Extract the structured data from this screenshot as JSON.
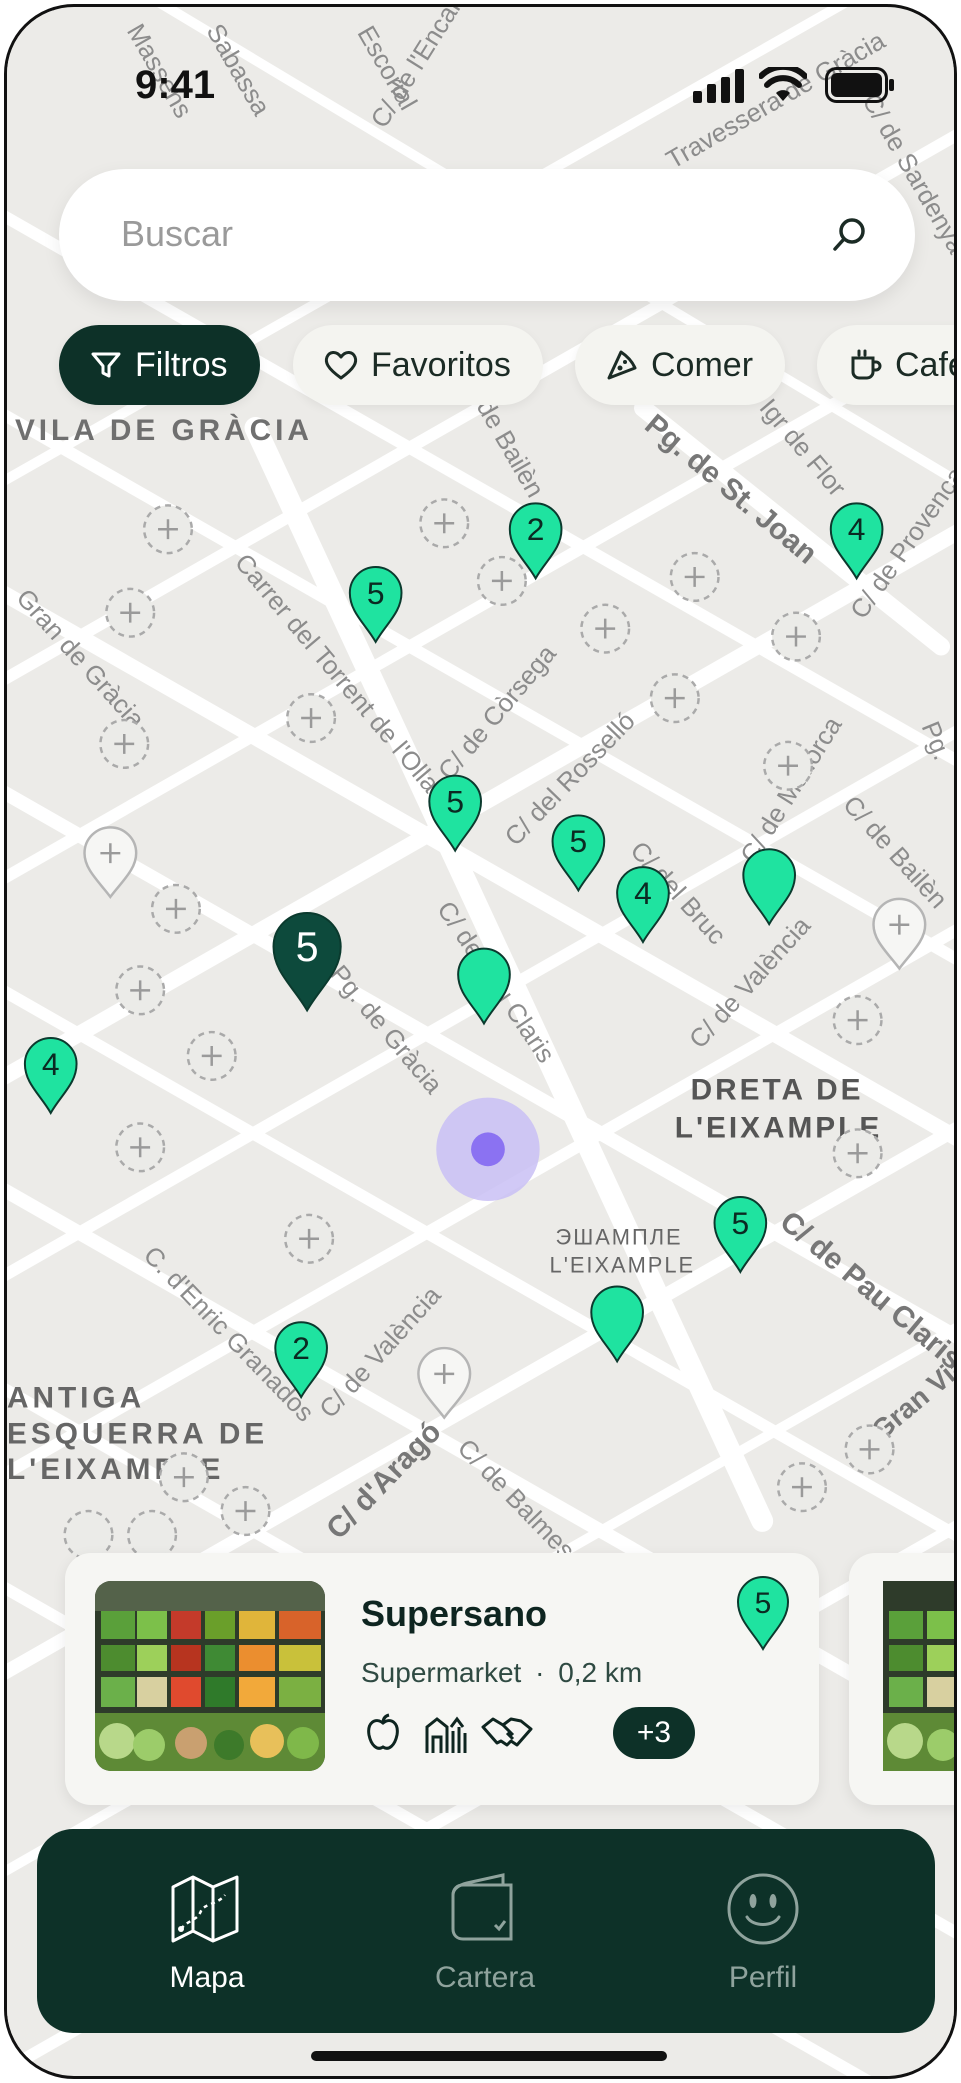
{
  "status_bar": {
    "time": "9:41"
  },
  "search": {
    "placeholder": "Buscar"
  },
  "chips": [
    {
      "label": "Filtros",
      "icon": "filter-icon",
      "active": true
    },
    {
      "label": "Favoritos",
      "icon": "heart-icon",
      "active": false
    },
    {
      "label": "Comer",
      "icon": "pizza-icon",
      "active": false
    },
    {
      "label": "Cafe",
      "icon": "coffee-icon",
      "active": false
    }
  ],
  "map": {
    "street_labels": [
      "Massens",
      "Sabassa",
      "Escorial",
      "C/ de l'Encarnació",
      "Travessera de Gràcia",
      "C/ de Sardenya",
      "VILA DE GRÀCIA",
      "de Bailèn",
      "Pg. de St. Joan",
      "Igr de Flor",
      "C/ de Provença",
      "Carrer del Torrent de l'Olla",
      "C/ de Còrsega",
      "C/ del Rosselló",
      "Gran de Gràcia",
      "C/ de Mallorca",
      "C/ de Bailèn",
      "C/ del Bruc",
      "C/ de Pau Claris",
      "C/ de València",
      "Pg. de Gràcia",
      "DRETA DE",
      "L'EIXAMPLE",
      "ЭШАМПЛЕ",
      "L'EIXAMPLE",
      "C/ de Pau Claris",
      "Gran Via",
      "C. d'Enric Granados",
      "C/ de València",
      "ANTIGA",
      "ESQUERRA DE",
      "L'EIXAMPLE",
      "C/ d'Aragó",
      "C/ de Balmes",
      "Pg."
    ],
    "pins": [
      {
        "count": "2"
      },
      {
        "count": "4"
      },
      {
        "count": "5"
      },
      {
        "count": "5"
      },
      {
        "count": "5"
      },
      {
        "count": "4"
      },
      {
        "count": ""
      },
      {
        "count": "5",
        "selected": true
      },
      {
        "count": ""
      },
      {
        "count": "4"
      },
      {
        "count": "5"
      },
      {
        "count": ""
      },
      {
        "count": "2"
      }
    ],
    "colors": {
      "pin": "#1fe3a0",
      "pin_selected": "#0d4a3c",
      "location": "#8b72f2"
    }
  },
  "card": {
    "title": "Supersano",
    "category": "Supermarket",
    "distance": "0,2 km",
    "separator": "·",
    "rating": "5",
    "icons": [
      "apple-icon",
      "farm-icon",
      "handshake-icon"
    ],
    "more": "+3"
  },
  "tabbar": {
    "tabs": [
      {
        "label": "Mapa",
        "icon": "map-icon",
        "active": true
      },
      {
        "label": "Cartera",
        "icon": "wallet-icon",
        "active": false
      },
      {
        "label": "Perfil",
        "icon": "smiley-icon",
        "active": false
      }
    ]
  },
  "theme": {
    "primary": "#0d3128",
    "accent": "#1fe3a0",
    "background": "#ecebe8"
  }
}
